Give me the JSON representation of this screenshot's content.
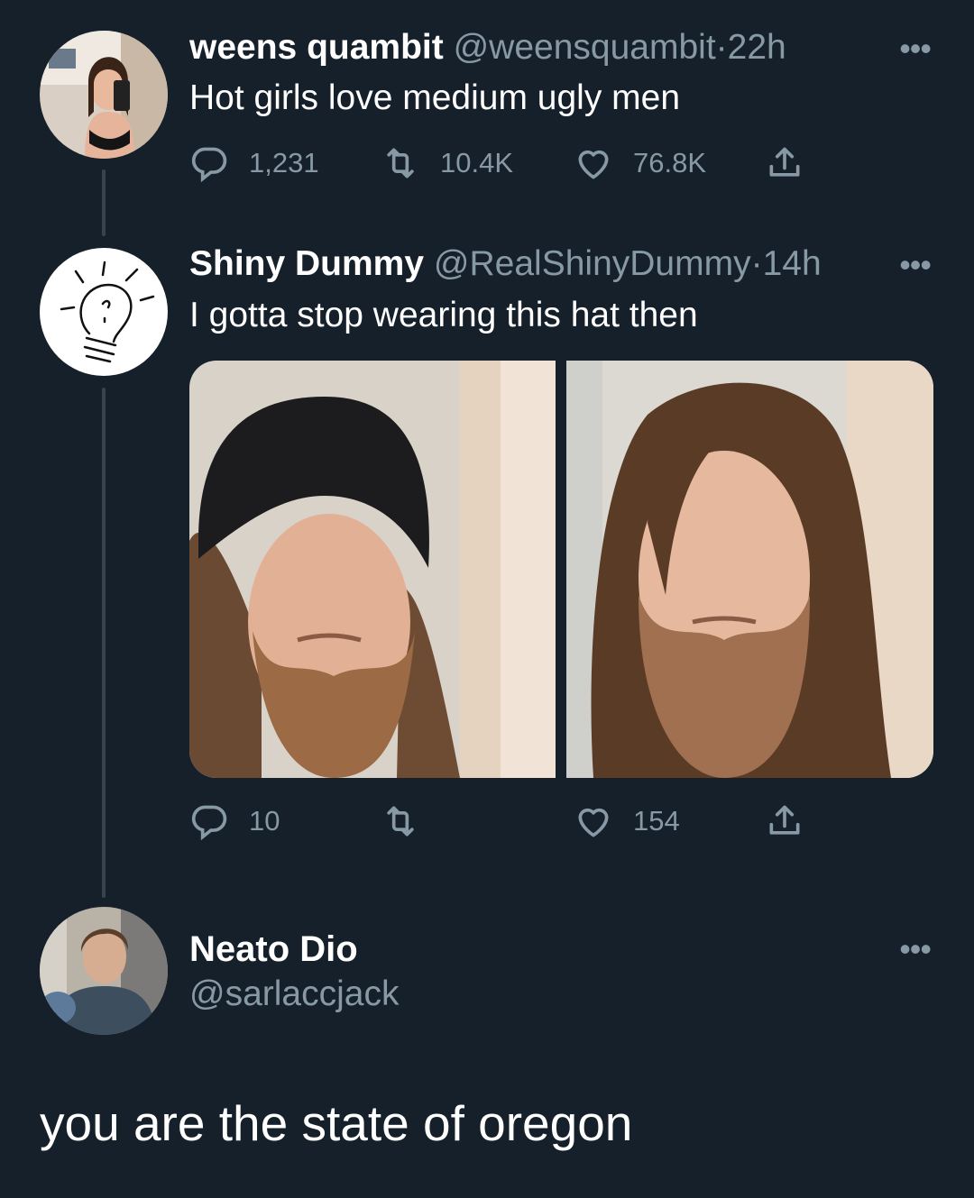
{
  "colors": {
    "background": "#15202b",
    "text_primary": "#ffffff",
    "text_secondary": "#8899a6",
    "thread_line": "#38444d"
  },
  "tweets": [
    {
      "name": "weens quambit",
      "handle": "@weensquambit",
      "separator": "·",
      "time": "22h",
      "text": "Hot girls love medium ugly men",
      "more_icon": "more-icon",
      "replies": "1,231",
      "retweets": "10.4K",
      "likes": "76.8K"
    },
    {
      "name": "Shiny Dummy",
      "handle": "@RealShinyDummy",
      "separator": "·",
      "time": "14h",
      "text": "I gotta stop wearing this hat then",
      "more_icon": "more-icon",
      "replies": "10",
      "retweets": "",
      "likes": "154"
    }
  ],
  "reply": {
    "name": "Neato Dio",
    "handle": "@sarlaccjack",
    "text": "you are the state of oregon"
  }
}
